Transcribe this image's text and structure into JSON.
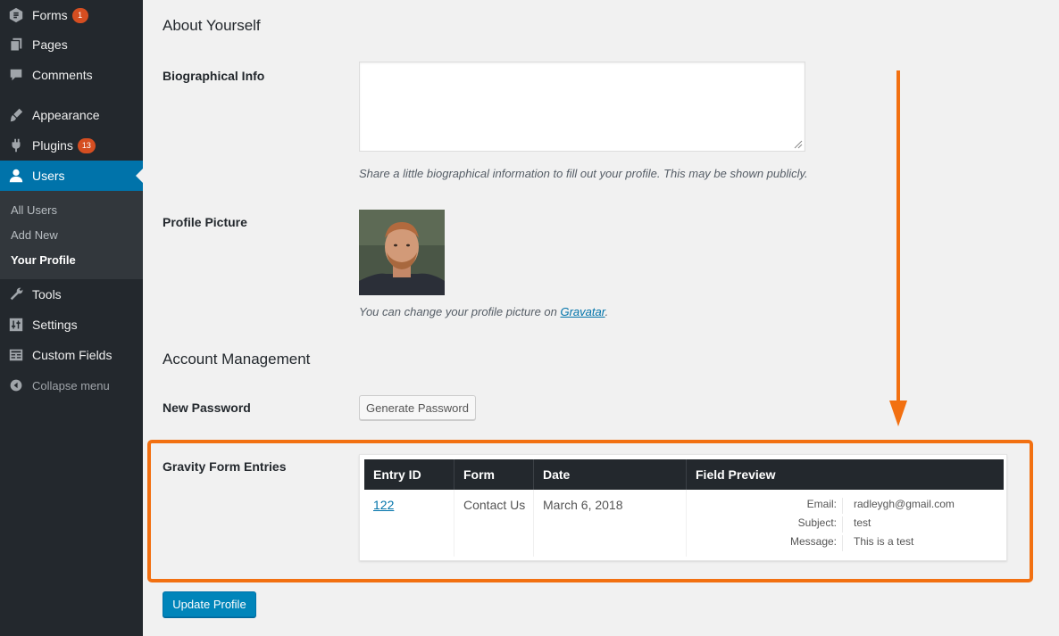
{
  "sidebar": {
    "items": [
      {
        "label": "Forms",
        "icon": "forms-icon",
        "badge": "1"
      },
      {
        "label": "Pages",
        "icon": "pages-icon"
      },
      {
        "label": "Comments",
        "icon": "comments-icon"
      },
      {
        "label": "Appearance",
        "icon": "appearance-icon"
      },
      {
        "label": "Plugins",
        "icon": "plugins-icon",
        "badge": "13"
      },
      {
        "label": "Users",
        "icon": "users-icon"
      },
      {
        "label": "Tools",
        "icon": "tools-icon"
      },
      {
        "label": "Settings",
        "icon": "settings-icon"
      },
      {
        "label": "Custom Fields",
        "icon": "custom-fields-icon"
      },
      {
        "label": "Collapse menu",
        "icon": "collapse-icon"
      }
    ],
    "submenu": [
      "All Users",
      "Add New",
      "Your Profile"
    ]
  },
  "about": {
    "heading": "About Yourself",
    "bio_label": "Biographical Info",
    "bio_value": "",
    "bio_desc": "Share a little biographical information to fill out your profile. This may be shown publicly.",
    "picture_label": "Profile Picture",
    "picture_desc_prefix": "You can change your profile picture on ",
    "picture_desc_link": "Gravatar",
    "picture_desc_suffix": "."
  },
  "account": {
    "heading": "Account Management",
    "password_label": "New Password",
    "generate_button": "Generate Password"
  },
  "gravity": {
    "label": "Gravity Form Entries",
    "columns": [
      "Entry ID",
      "Form",
      "Date",
      "Field Preview"
    ],
    "rows": [
      {
        "entry_id": "122",
        "form": "Contact Us",
        "date": "March 6, 2018",
        "fields": [
          {
            "key": "Email:",
            "value": "radleygh@gmail.com"
          },
          {
            "key": "Subject:",
            "value": "test"
          },
          {
            "key": "Message:",
            "value": "This is a test"
          }
        ]
      }
    ]
  },
  "footer": {
    "update_button": "Update Profile"
  },
  "colors": {
    "accent": "#f27011",
    "wp_blue": "#0073aa",
    "sidebar_bg": "#23282d"
  }
}
